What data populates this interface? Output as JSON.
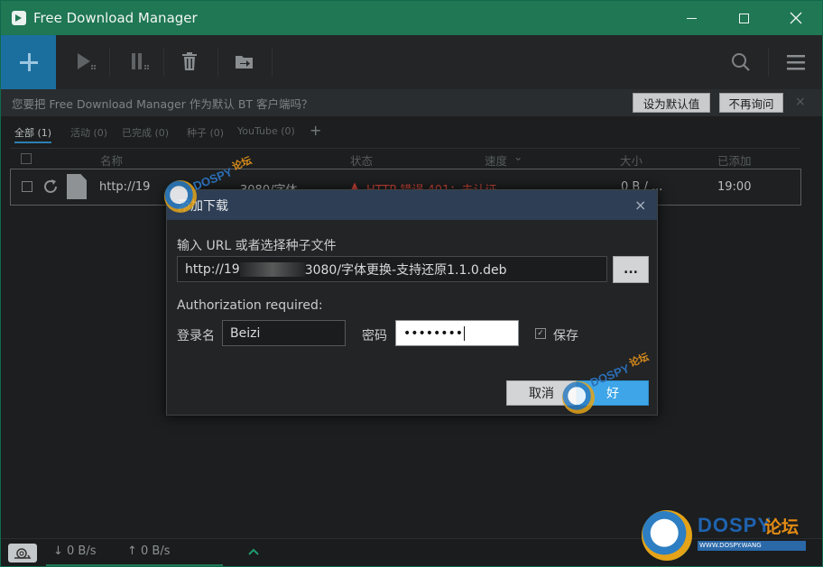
{
  "window": {
    "title": "Free Download Manager"
  },
  "notice": {
    "text": "您要把 Free Download Manager 作为默认 BT 客户端吗？",
    "set_default": "设为默认值",
    "dont_ask": "不再询问",
    "close": "×"
  },
  "tabs": [
    {
      "label": "全部 (1)"
    },
    {
      "label": "活动 (0)"
    },
    {
      "label": "已完成 (0)"
    },
    {
      "label": "种子 (0)"
    },
    {
      "label": "YouTube (0)"
    }
  ],
  "tab_add": "+",
  "columns": {
    "name": "名称",
    "status": "状态",
    "speed": "速度",
    "speed_sort": "⌄",
    "size": "大小",
    "added": "已添加"
  },
  "row": {
    "name_start": "http://19",
    "name_end": "3080/字体",
    "status": "HTTP 错误 401：未认证",
    "size": "0 B / ...",
    "added": "19:00"
  },
  "dialog": {
    "title": "添加下载",
    "close": "×",
    "url_label": "输入 URL 或者选择种子文件",
    "url_start": "http://19",
    "url_end": "3080/字体更换-支持还原1.1.0.deb",
    "browse": "...",
    "auth_label": "Authorization required:",
    "user_label": "登录名",
    "user_value": "Beizi",
    "pass_label": "密码",
    "pass_value": "••••••••",
    "save_label": "保存",
    "cancel": "取消",
    "ok": "好"
  },
  "statusbar": {
    "down": "↓ 0 B/s",
    "up": "↑ 0 B/s"
  },
  "watermark": {
    "brand": "DOSPY",
    "brand_cn": "论坛",
    "url": "WWW.DOSPY.WANG"
  },
  "colors": {
    "titlebar": "#1f7754",
    "add_button": "#1b6f9f",
    "ok_button": "#3ea6e8",
    "error": "#d8473a"
  }
}
